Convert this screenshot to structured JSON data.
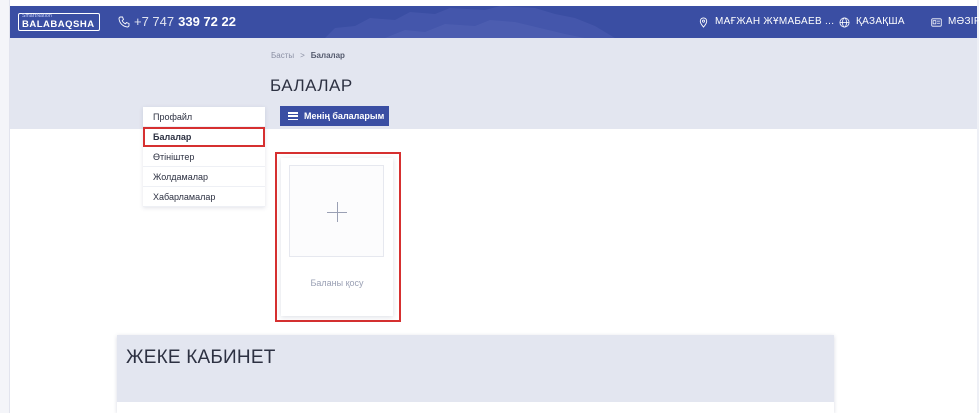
{
  "topbar": {
    "logo_small": "SmartNation",
    "logo_big": "BALABAQSHA",
    "phone_prefix": "+7 747",
    "phone_number": "339 72 22",
    "location": "МАҒЖАН ЖҰМАБАЕВ ...",
    "language": "ҚАЗАҚША",
    "menu": "МӘЗІР"
  },
  "breadcrumb": {
    "home": "Басты",
    "separator": ">",
    "current": "Балалар"
  },
  "page_title": "БАЛАЛАР",
  "sidebar": {
    "items": [
      {
        "label": "Профайл"
      },
      {
        "label": "Балалар"
      },
      {
        "label": "Өтініштер"
      },
      {
        "label": "Жолдамалар"
      },
      {
        "label": "Хабарламалар"
      }
    ],
    "active_index": 1
  },
  "tab": {
    "label": "Менің балаларым"
  },
  "add_child": {
    "label": "Баланы қосу"
  },
  "cabinet": {
    "title": "ЖЕКЕ КАБИНЕТ"
  },
  "colors": {
    "primary": "#3a4ea3",
    "band": "#e3e6f0",
    "highlight": "#d63030"
  }
}
